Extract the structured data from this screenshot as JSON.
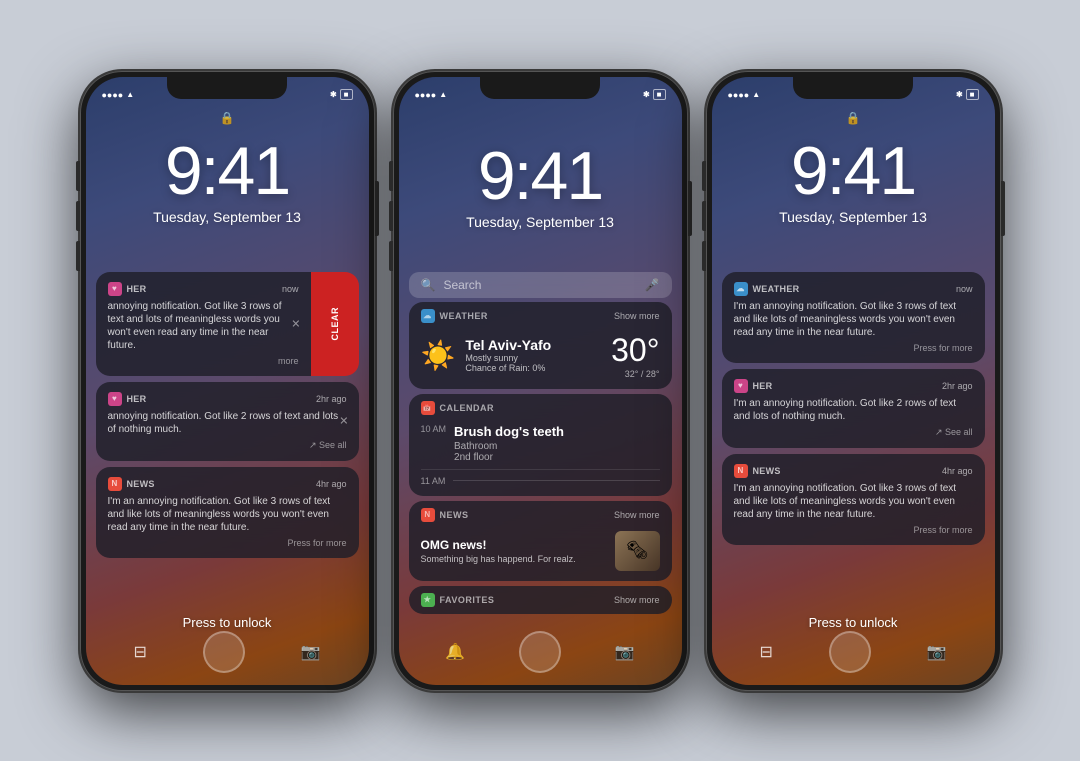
{
  "page": {
    "bg_color": "#c5c9d2"
  },
  "phone1": {
    "time": "9:41",
    "date": "Tuesday, September 13",
    "notifications": [
      {
        "app": "HER",
        "app_color": "#cc4488",
        "time": "now",
        "show_clear": true,
        "body": "annoying notification. Got like 3 rows of text and lots of meaningless words you won't even read any time in the near future.",
        "more": "more"
      },
      {
        "app": "HER",
        "app_color": "#cc4488",
        "time": "2hr ago",
        "body": "annoying notification. Got like 2 rows of text and lots of nothing much.",
        "see_all": "See all"
      },
      {
        "app": "NEWS",
        "app_color": "#e74c3c",
        "time": "4hr ago",
        "body": "I'm an annoying notification. Got like 3 rows of text and like lots of meaningless words you won't even read any time in the near future.",
        "press_more": "Press for more"
      }
    ],
    "press_unlock": "Press to unlock",
    "clear_label": "CLEAR"
  },
  "phone2": {
    "time": "9:41",
    "date": "Tuesday, September 13",
    "search_placeholder": "Search",
    "widgets": {
      "weather": {
        "app_name": "WEATHER",
        "show_more": "Show more",
        "city": "Tel Aviv-Yafo",
        "description": "Mostly sunny",
        "rain": "Chance of Rain: 0%",
        "temp": "30°",
        "range": "32° / 28°",
        "icon": "☀️"
      },
      "calendar": {
        "app_name": "CALENDAR",
        "event_title": "Brush dog's teeth",
        "event_location": "Bathroom",
        "event_floor": "2nd floor",
        "time1": "10 AM",
        "time2": "11 AM"
      },
      "news": {
        "app_name": "NEWS",
        "show_more": "Show more",
        "title": "OMG news!",
        "description": "Something big has happend. For realz."
      },
      "favorites": {
        "app_name": "FAVORITES",
        "show_more": "Show more"
      }
    }
  },
  "phone3": {
    "time": "9:41",
    "date": "Tuesday, September 13",
    "notifications": [
      {
        "app": "WEATHER",
        "app_color": "#3a8fc9",
        "time": "now",
        "body": "I'm an annoying notification. Got like 3 rows of text and like lots of meaningless words you won't even read any time in the near future.",
        "press_more": "Press for more"
      },
      {
        "app": "HER",
        "app_color": "#cc4488",
        "time": "2hr ago",
        "body": "I'm an annoying notification. Got like 2 rows of text and lots of nothing much.",
        "see_all": "See all"
      },
      {
        "app": "NEWS",
        "app_color": "#e74c3c",
        "time": "4hr ago",
        "body": "I'm an annoying notification. Got like 3 rows of text and like lots of meaningless words you won't even read any time in the near future.",
        "press_more": "Press for more"
      }
    ],
    "press_unlock": "Press to unlock"
  },
  "icons": {
    "search": "🔍",
    "mic": "🎤",
    "bell": "🔔",
    "camera": "📷",
    "grid": "⊞",
    "lock": "🔒"
  }
}
